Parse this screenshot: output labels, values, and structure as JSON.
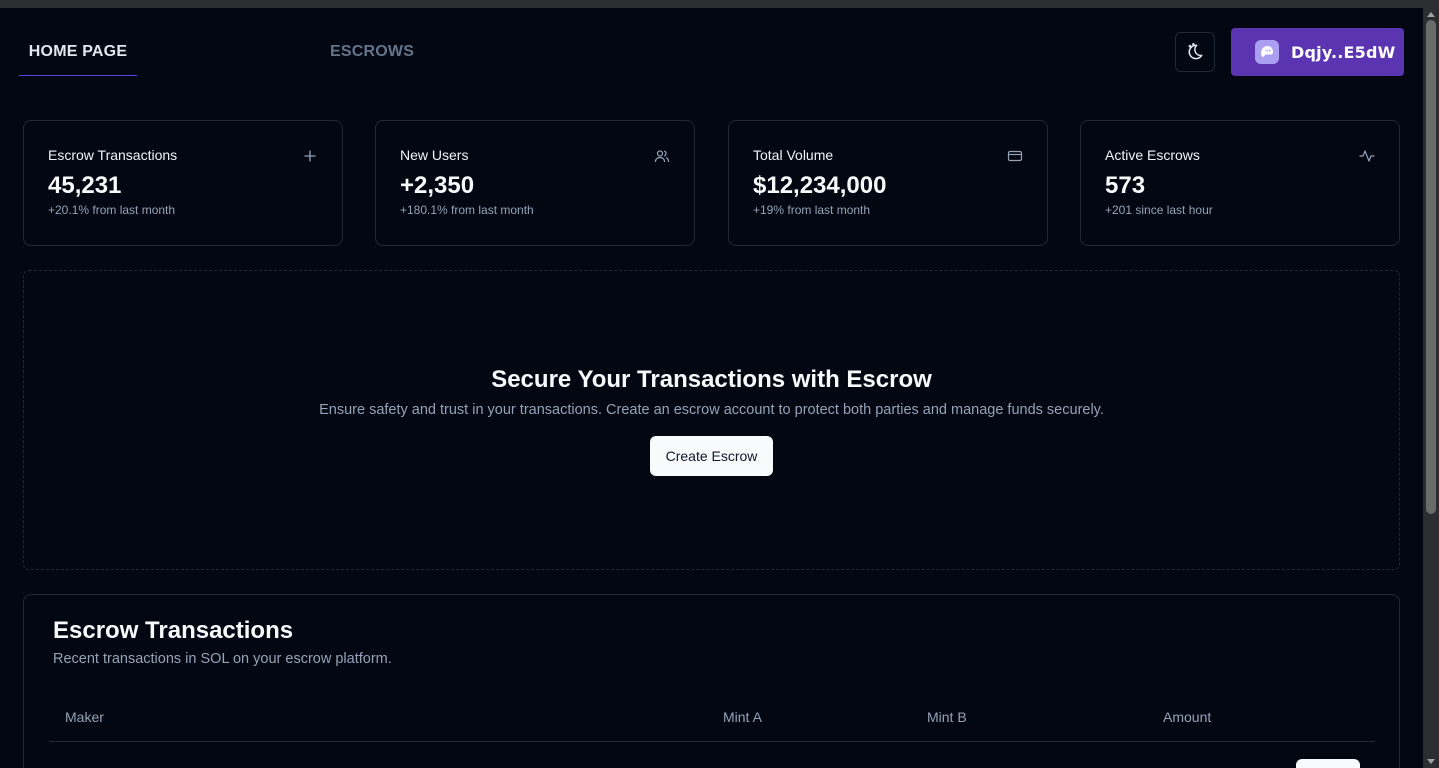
{
  "nav": {
    "tabs": [
      {
        "label": "HOME PAGE",
        "active": true
      },
      {
        "label": "ESCROWS",
        "active": false
      }
    ],
    "theme_toggle_icon": "moon-stars-icon",
    "wallet": {
      "label": "Dqjy..E5dW",
      "icon": "phantom-ghost-icon",
      "color": "#5b34b1"
    }
  },
  "stats": [
    {
      "title": "Escrow Transactions",
      "value": "45,231",
      "sub": "+20.1% from last month",
      "icon": "plus-icon"
    },
    {
      "title": "New Users",
      "value": "+2,350",
      "sub": "+180.1% from last month",
      "icon": "users-icon"
    },
    {
      "title": "Total Volume",
      "value": "$12,234,000",
      "sub": "+19% from last month",
      "icon": "credit-card-icon"
    },
    {
      "title": "Active Escrows",
      "value": "573",
      "sub": "+201 since last hour",
      "icon": "activity-icon"
    }
  ],
  "hero": {
    "title": "Secure Your Transactions with Escrow",
    "description": "Ensure safety and trust in your transactions. Create an escrow account to protect both parties and manage funds securely.",
    "button": "Create Escrow"
  },
  "transactions": {
    "title": "Escrow Transactions",
    "description": "Recent transactions in SOL on your escrow platform.",
    "columns": [
      "Maker",
      "Mint A",
      "Mint B",
      "Amount"
    ]
  },
  "colors": {
    "background": "#030712",
    "border": "#1f2937",
    "accent": "#4f46e5",
    "muted_text": "#94a3b8"
  }
}
